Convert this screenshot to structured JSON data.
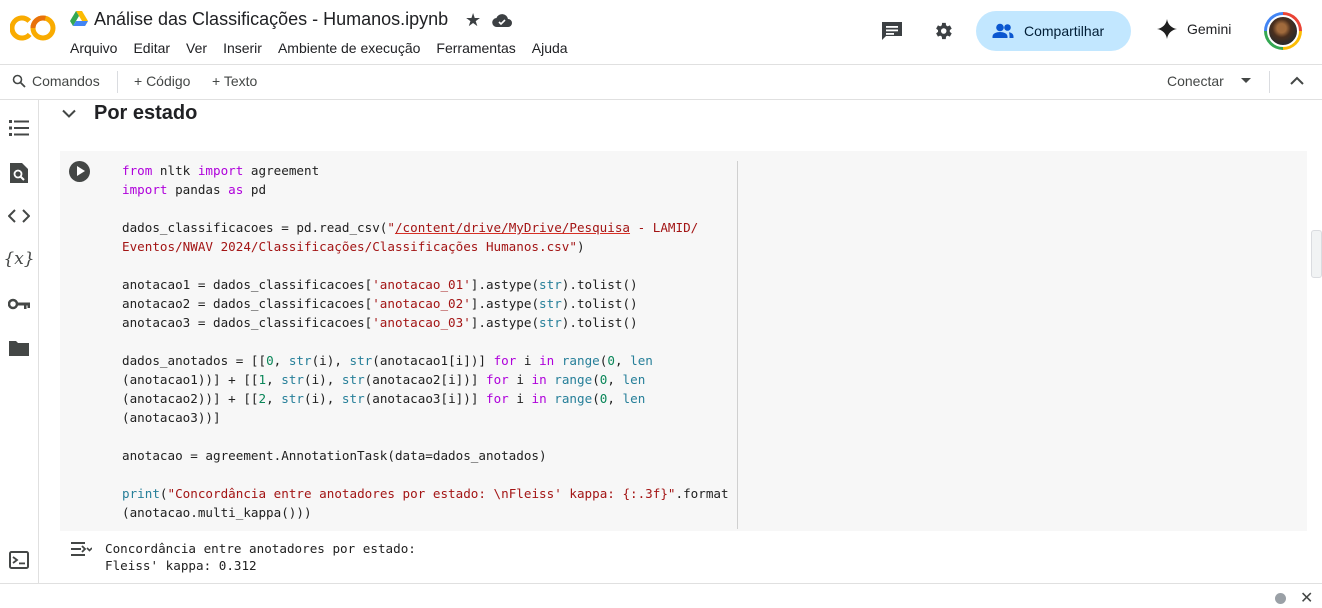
{
  "header": {
    "logo_text": "CO",
    "notebook_title": "Análise das Classificações - Humanos.ipynb",
    "menu": [
      "Arquivo",
      "Editar",
      "Ver",
      "Inserir",
      "Ambiente de execução",
      "Ferramentas",
      "Ajuda"
    ],
    "share_label": "Compartilhar",
    "gemini_label": "Gemini"
  },
  "toolbar": {
    "commands_label": "Comandos",
    "add_code_label": "+ Código",
    "add_text_label": "+ Texto",
    "connect_label": "Conectar"
  },
  "section": {
    "title": "Por estado"
  },
  "cell": {
    "lines": [
      "from nltk import agreement",
      "import pandas as pd",
      "",
      "dados_classificacoes = pd.read_csv(\"/content/drive/MyDrive/Pesquisa - LAMID/",
      "Eventos/NWAV 2024/Classificações/Classificações Humanos.csv\")",
      "",
      "anotacao1 = dados_classificacoes['anotacao_01'].astype(str).tolist()",
      "anotacao2 = dados_classificacoes['anotacao_02'].astype(str).tolist()",
      "anotacao3 = dados_classificacoes['anotacao_03'].astype(str).tolist()",
      "",
      "dados_anotados = [[0, str(i), str(anotacao1[i])] for i in range(0, len",
      "(anotacao1))] + [[1, str(i), str(anotacao2[i])] for i in range(0, len",
      "(anotacao2))] + [[2, str(i), str(anotacao3[i])] for i in range(0, len",
      "(anotacao3))]",
      "",
      "anotacao = agreement.AnnotationTask(data=dados_anotados)",
      "",
      "print(\"Concordância entre anotadores por estado: \\nFleiss' kappa: {:.3f}\".format",
      "(anotacao.multi_kappa()))"
    ]
  },
  "output": {
    "line1": "Concordância entre anotadores por estado:",
    "line2": "Fleiss' kappa: 0.312"
  },
  "colors": {
    "accent_share_bg": "#c2e7ff",
    "logo_orange": "#f9ab00",
    "keyword": "#af00db",
    "builtin": "#267f99",
    "string": "#a31515",
    "number": "#098658"
  }
}
